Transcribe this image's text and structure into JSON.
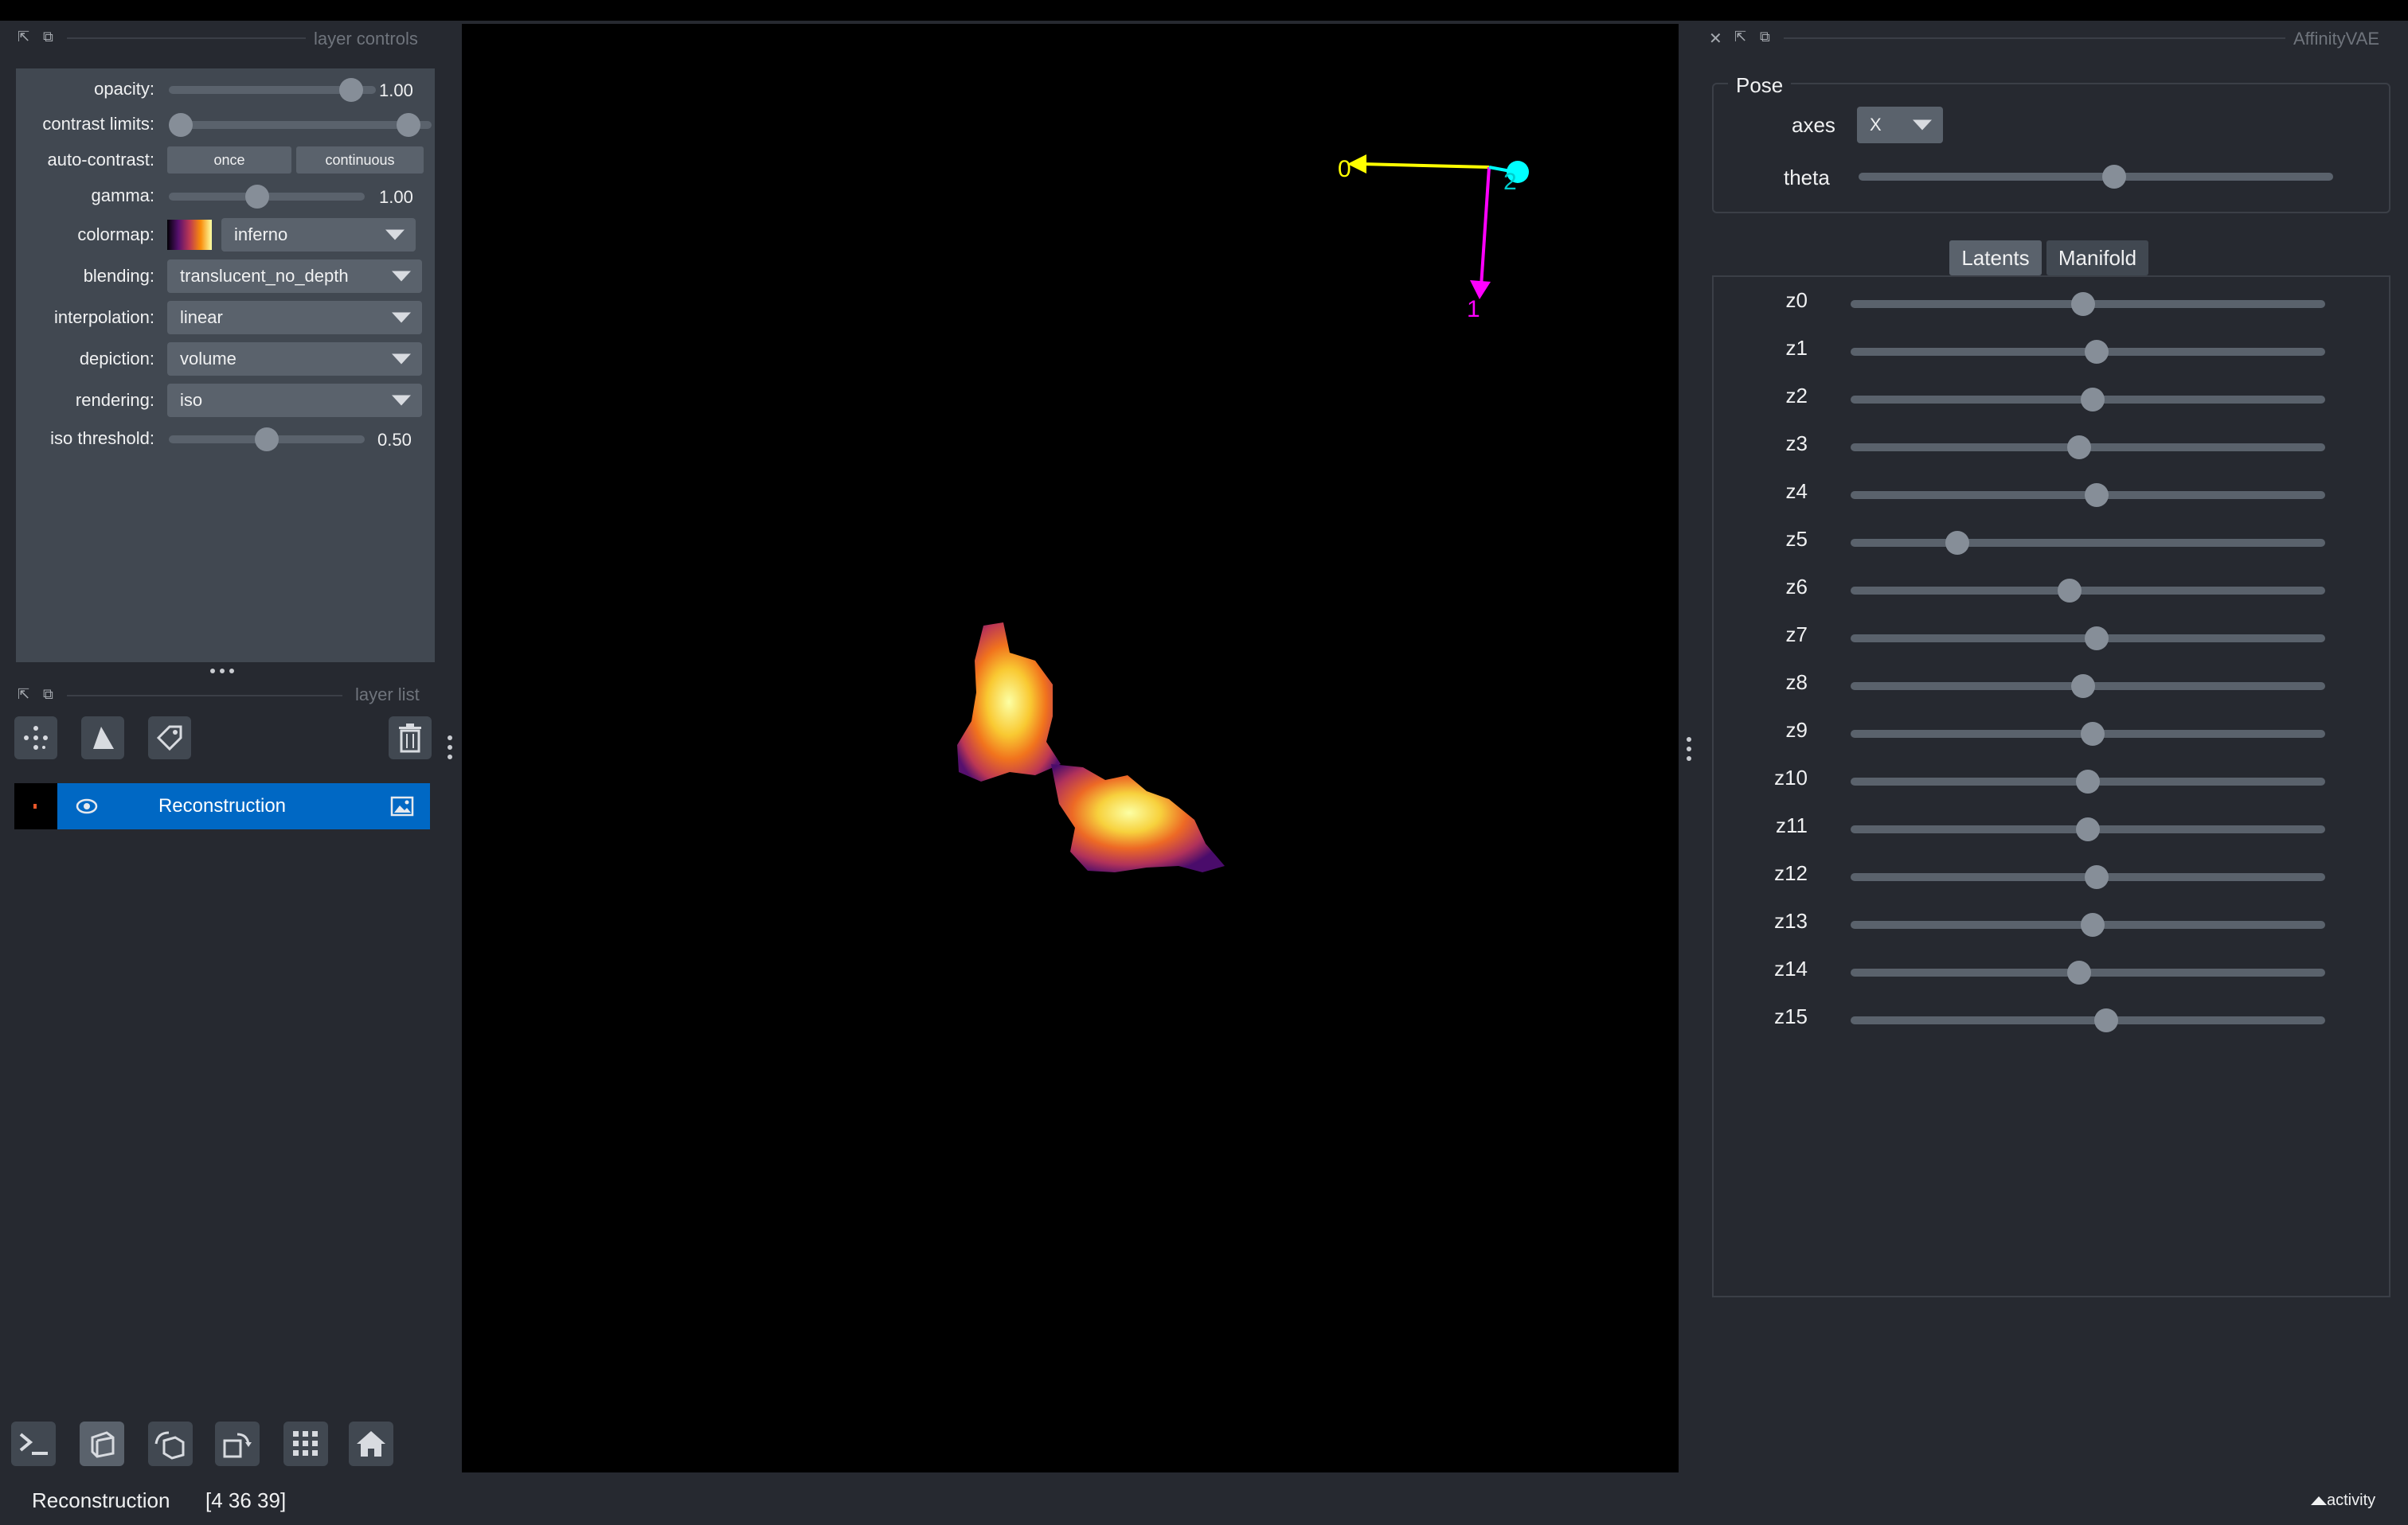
{
  "left": {
    "layer_controls_title": "layer controls",
    "opacity": {
      "label": "opacity:",
      "value": "1.00",
      "fraction": 1.0
    },
    "contrast": {
      "label": "contrast limits:",
      "low": 0.0,
      "high": 1.0
    },
    "auto_contrast": {
      "label": "auto-contrast:",
      "once": "once",
      "continuous": "continuous"
    },
    "gamma": {
      "label": "gamma:",
      "value": "1.00",
      "fraction": 0.45
    },
    "colormap": {
      "label": "colormap:",
      "value": "inferno"
    },
    "blending": {
      "label": "blending:",
      "value": "translucent_no_depth"
    },
    "interpolation": {
      "label": "interpolation:",
      "value": "linear"
    },
    "depiction": {
      "label": "depiction:",
      "value": "volume"
    },
    "rendering": {
      "label": "rendering:",
      "value": "iso"
    },
    "iso_threshold": {
      "label": "iso threshold:",
      "value": "0.50",
      "fraction": 0.5
    },
    "layer_list_title": "layer list",
    "layer_name": "Reconstruction"
  },
  "canvas": {
    "axes": {
      "x_label": "0",
      "y_label": "1",
      "z_label": "2",
      "colors": {
        "x": "#ffff00",
        "y": "#ff00ff",
        "z": "#00ffff"
      }
    }
  },
  "right": {
    "title": "AffinityVAE",
    "pose": {
      "group": "Pose",
      "axes_label": "axes",
      "axes_value": "X",
      "theta_label": "theta",
      "theta_fraction": 0.54
    },
    "tabs": [
      "Latents",
      "Manifold"
    ],
    "active_tab": "Latents",
    "latents": [
      {
        "name": "z0",
        "fraction": 0.49
      },
      {
        "name": "z1",
        "fraction": 0.52
      },
      {
        "name": "z2",
        "fraction": 0.51
      },
      {
        "name": "z3",
        "fraction": 0.48
      },
      {
        "name": "z4",
        "fraction": 0.52
      },
      {
        "name": "z5",
        "fraction": 0.21
      },
      {
        "name": "z6",
        "fraction": 0.46
      },
      {
        "name": "z7",
        "fraction": 0.52
      },
      {
        "name": "z8",
        "fraction": 0.49
      },
      {
        "name": "z9",
        "fraction": 0.51
      },
      {
        "name": "z10",
        "fraction": 0.5
      },
      {
        "name": "z11",
        "fraction": 0.5
      },
      {
        "name": "z12",
        "fraction": 0.52
      },
      {
        "name": "z13",
        "fraction": 0.51
      },
      {
        "name": "z14",
        "fraction": 0.48
      },
      {
        "name": "z15",
        "fraction": 0.54
      }
    ]
  },
  "status": {
    "layer": "Reconstruction",
    "coords": "[4 36 39]",
    "activity": "activity"
  },
  "colors": {
    "accent": "#0068c4",
    "panel": "#414851",
    "background": "#262930"
  }
}
